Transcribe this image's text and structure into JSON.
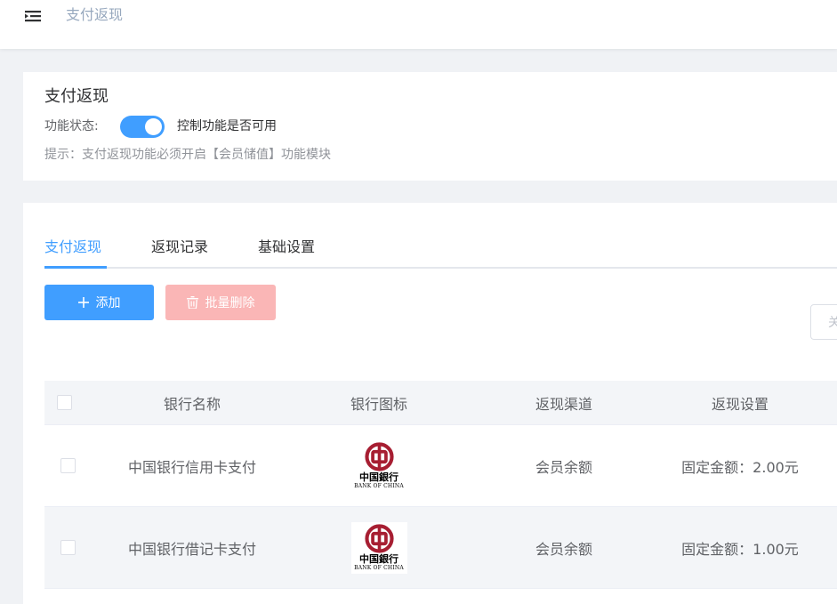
{
  "header": {
    "menu_icon": "menu-fold-icon",
    "title": "支付返现"
  },
  "settings_card": {
    "title": "支付返现",
    "status_label": "功能状态:",
    "switch_on": true,
    "switch_desc": "控制功能是否可用",
    "tip": "提示：支付返现功能必须开启【会员储值】功能模块"
  },
  "tabs": [
    {
      "label": "支付返现",
      "active": true
    },
    {
      "label": "返现记录",
      "active": false
    },
    {
      "label": "基础设置",
      "active": false
    }
  ],
  "toolbar": {
    "add_label": "添加",
    "batch_delete_label": "批量删除",
    "search_placeholder_partial": "关"
  },
  "table": {
    "columns": [
      "银行名称",
      "银行图标",
      "返现渠道",
      "返现设置"
    ],
    "rows": [
      {
        "name": "中国银行信用卡支付",
        "logo": {
          "cn": "中国銀行",
          "en": "BANK OF CHINA"
        },
        "channel": "会员余额",
        "setting": "固定金额：2.00元"
      },
      {
        "name": "中国银行借记卡支付",
        "logo": {
          "cn": "中国銀行",
          "en": "BANK OF CHINA"
        },
        "channel": "会员余额",
        "setting": "固定金额：1.00元"
      }
    ]
  },
  "colors": {
    "primary": "#409eff",
    "danger_disabled": "#fab6b6",
    "bank_red": "#a71e32"
  }
}
